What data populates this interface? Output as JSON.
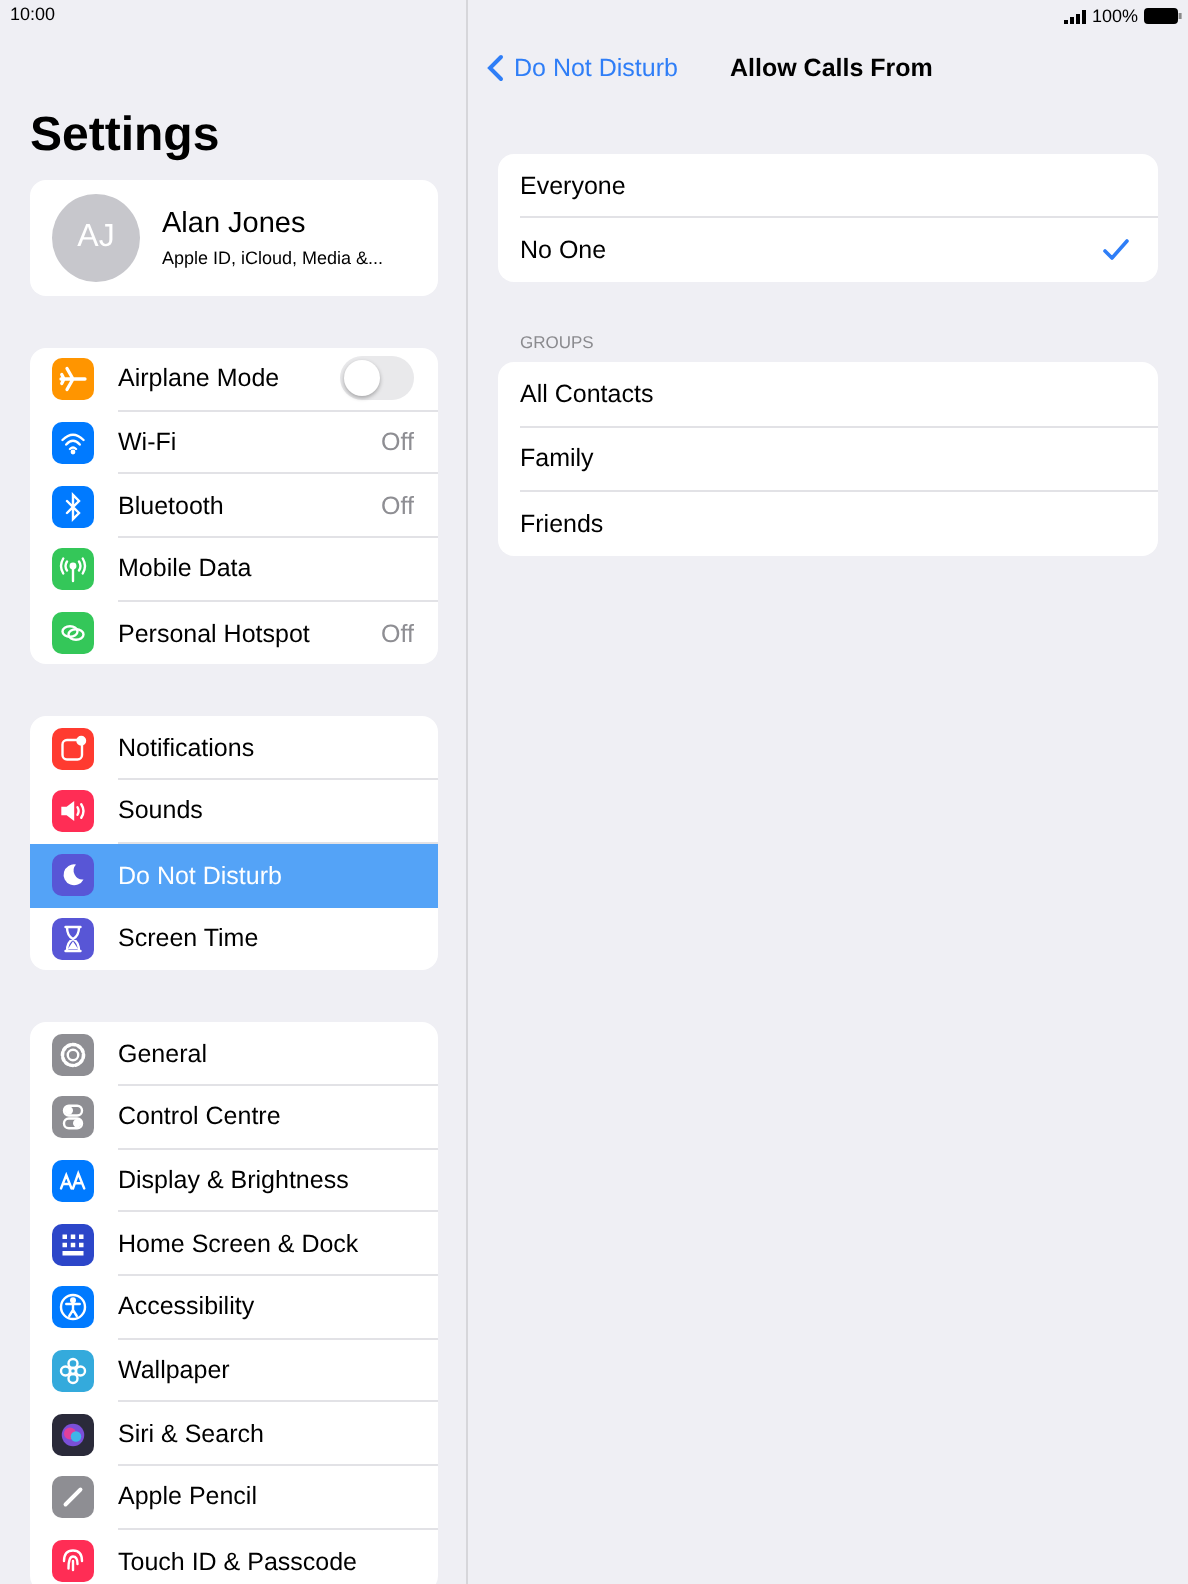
{
  "status_bar": {
    "time": "10:00",
    "battery": "100%"
  },
  "sidebar": {
    "title": "Settings",
    "profile": {
      "initials": "AJ",
      "name": "Alan Jones",
      "subtitle": "Apple ID, iCloud, Media &..."
    },
    "groups": [
      {
        "items": [
          {
            "kind": "toggle",
            "label": "Airplane Mode",
            "on": false,
            "selected": false,
            "color": "#ff9500"
          },
          {
            "kind": "link",
            "label": "Wi-Fi",
            "value": "Off",
            "selected": false,
            "color": "#007aff"
          },
          {
            "kind": "link",
            "label": "Bluetooth",
            "value": "Off",
            "selected": false,
            "color": "#007aff"
          },
          {
            "kind": "link",
            "label": "Mobile Data",
            "selected": false,
            "color": "#34c759"
          },
          {
            "kind": "link",
            "label": "Personal Hotspot",
            "value": "Off",
            "selected": false,
            "color": "#34c759"
          }
        ]
      },
      {
        "items": [
          {
            "kind": "link",
            "label": "Notifications",
            "selected": false,
            "color": "#ff3b30"
          },
          {
            "kind": "link",
            "label": "Sounds",
            "selected": false,
            "color": "#ff2d55"
          },
          {
            "kind": "link",
            "label": "Do Not Disturb",
            "selected": true,
            "color": "#5856d6"
          },
          {
            "kind": "link",
            "label": "Screen Time",
            "selected": false,
            "color": "#5856d6"
          }
        ]
      },
      {
        "items": [
          {
            "kind": "link",
            "label": "General",
            "selected": false,
            "color": "#8e8e93"
          },
          {
            "kind": "link",
            "label": "Control Centre",
            "selected": false,
            "color": "#8e8e93"
          },
          {
            "kind": "link",
            "label": "Display & Brightness",
            "selected": false,
            "color": "#007aff"
          },
          {
            "kind": "link",
            "label": "Home Screen & Dock",
            "selected": false,
            "color": "#2c46c9"
          },
          {
            "kind": "link",
            "label": "Accessibility",
            "selected": false,
            "color": "#007aff"
          },
          {
            "kind": "link",
            "label": "Wallpaper",
            "selected": false,
            "color": "#34aadc"
          },
          {
            "kind": "link",
            "label": "Siri & Search",
            "selected": false,
            "color": "#2a2a3a"
          },
          {
            "kind": "link",
            "label": "Apple Pencil",
            "selected": false,
            "color": "#8e8e93"
          },
          {
            "kind": "link",
            "label": "Touch ID & Passcode",
            "selected": false,
            "color": "#ff2d55"
          }
        ]
      }
    ]
  },
  "detail": {
    "back": "Do Not Disturb",
    "title": "Allow Calls From",
    "options": [
      {
        "label": "Everyone",
        "selected": false
      },
      {
        "label": "No One",
        "selected": true
      }
    ],
    "groups_header": "GROUPS",
    "groups": [
      {
        "label": "All Contacts",
        "selected": false
      },
      {
        "label": "Family",
        "selected": false
      },
      {
        "label": "Friends",
        "selected": false
      }
    ]
  }
}
